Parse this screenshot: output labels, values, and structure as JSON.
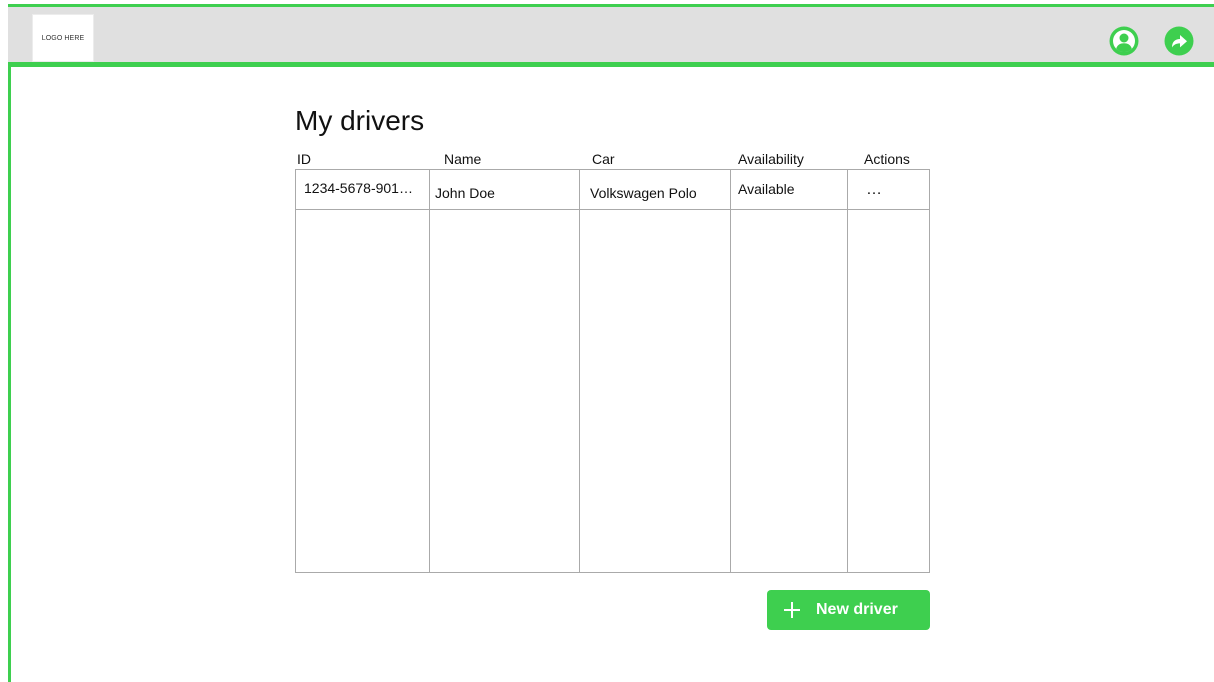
{
  "header": {
    "logo_text": "LOGO HERE",
    "icons": {
      "profile": "user-circle-icon",
      "logout": "share-arrow-icon"
    }
  },
  "page": {
    "title": "My drivers"
  },
  "table": {
    "columns": [
      "ID",
      "Name",
      "Car",
      "Availability",
      "Actions"
    ],
    "rows": [
      {
        "id": "1234-5678-901…",
        "name": "John Doe",
        "car": "Volkswagen Polo",
        "availability": "Available",
        "actions": "…"
      }
    ]
  },
  "actions": {
    "new_driver_label": "New driver"
  },
  "colors": {
    "accent": "#3ecf4f",
    "header_bg": "#e0e0e0",
    "border": "#aaaaaa"
  }
}
